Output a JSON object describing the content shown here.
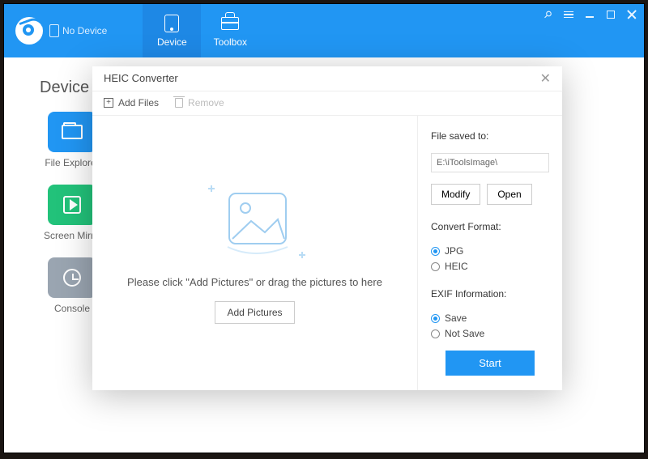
{
  "header": {
    "device_status": "No Device",
    "tabs": {
      "device": "Device",
      "toolbox": "Toolbox"
    }
  },
  "body": {
    "title": "Device",
    "tiles": {
      "file_explorer": "File Explorer",
      "screen_mirror": "Screen Mirror",
      "console": "Console"
    }
  },
  "modal": {
    "title": "HEIC Converter",
    "toolbar": {
      "add_files": "Add Files",
      "remove": "Remove"
    },
    "drop_text": "Please click \"Add Pictures\" or drag the pictures to here",
    "add_pictures": "Add Pictures",
    "side": {
      "saved_to_label": "File saved to:",
      "saved_to_path": "E:\\iToolsImage\\",
      "modify": "Modify",
      "open": "Open",
      "format_label": "Convert Format:",
      "format": {
        "jpg": "JPG",
        "heic": "HEIC",
        "selected": "jpg"
      },
      "exif_label": "EXIF Information:",
      "exif": {
        "save": "Save",
        "not_save": "Not Save",
        "selected": "save"
      },
      "start": "Start"
    }
  },
  "colors": {
    "primary": "#2196f3"
  }
}
